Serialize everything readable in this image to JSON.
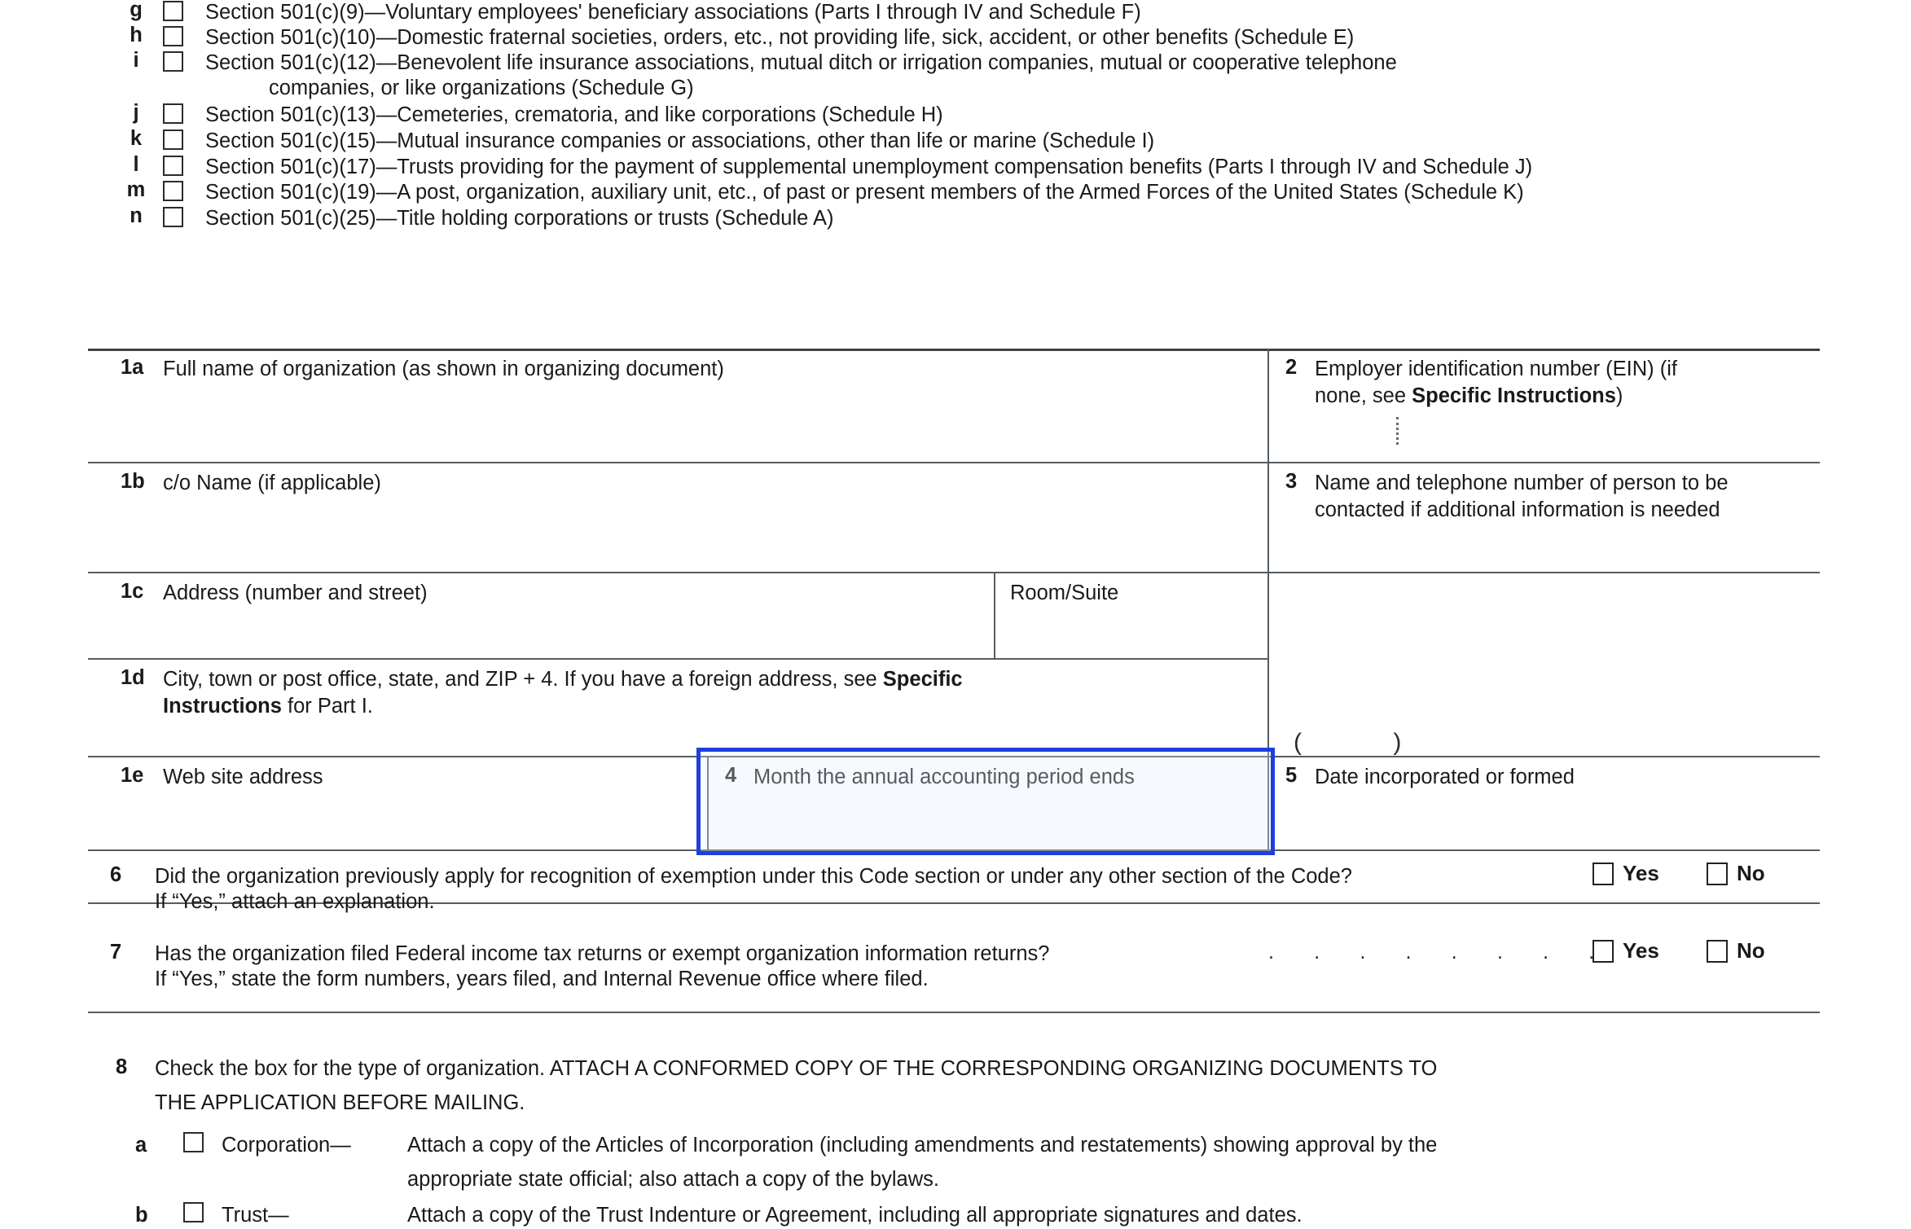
{
  "form": {
    "checkbox_options": [
      {
        "letter": "g",
        "text": "Section 501(c)(9)—Voluntary employees' beneficiary associations (Parts I through IV and Schedule F)"
      },
      {
        "letter": "h",
        "text": "Section 501(c)(10)—Domestic fraternal societies, orders, etc., not providing life, sick, accident, or other benefits (Schedule E)"
      },
      {
        "letter": "i",
        "text": "Section 501(c)(12)—Benevolent life insurance associations, mutual ditch or irrigation companies, mutual or cooperative telephone",
        "continuation": "companies, or like organizations (Schedule G)"
      },
      {
        "letter": "j",
        "text": "Section 501(c)(13)—Cemeteries, crematoria, and like corporations (Schedule H)"
      },
      {
        "letter": "k",
        "text": "Section 501(c)(15)—Mutual insurance companies or associations, other than life or marine (Schedule I)"
      },
      {
        "letter": "l",
        "text": "Section 501(c)(17)—Trusts providing for the payment of supplemental unemployment compensation benefits (Parts I through IV and  Schedule J)"
      },
      {
        "letter": "m",
        "text": "Section 501(c)(19)—A post, organization, auxiliary unit, etc., of past or present members of the Armed Forces of the United States (Schedule K)"
      },
      {
        "letter": "n",
        "text": "Section 501(c)(25)—Title holding corporations or trusts (Schedule A)"
      }
    ],
    "fields": {
      "f1a": {
        "num": "1a",
        "label": "Full name of organization (as shown in organizing document)"
      },
      "f2": {
        "num": "2",
        "label_part1": "Employer identification number (EIN) (if",
        "label_part2_pre": "none, see ",
        "label_part2_bold": "Specific Instructions",
        "label_part2_post": ")"
      },
      "f1b": {
        "num": "1b",
        "label": "c/o Name (if applicable)"
      },
      "f3": {
        "num": "3",
        "label_line1": "Name and telephone number of person to be",
        "label_line2": "contacted if additional information is needed"
      },
      "f1c": {
        "num": "1c",
        "label": "Address (number and street)"
      },
      "room_suite": {
        "label": "Room/Suite"
      },
      "f1d": {
        "num": "1d",
        "label_pre": "City, town or post office, state, and ZIP + 4. If you have a foreign address, see ",
        "label_bold": "Specific",
        "label_line2_bold": "Instructions",
        "label_line2_post": " for Part I."
      },
      "f1e": {
        "num": "1e",
        "label": "Web site address"
      },
      "f4": {
        "num": "4",
        "label": "Month the annual accounting period ends"
      },
      "f5": {
        "num": "5",
        "label": "Date incorporated or formed"
      },
      "phone_paren": "( )"
    },
    "questions": [
      {
        "num": "6",
        "line1": "Did the organization previously apply for recognition of exemption under this Code section or under any other section of the Code?",
        "line2": "If “Yes,” attach an explanation.",
        "yes_label": "Yes",
        "no_label": "No",
        "leaders": ""
      },
      {
        "num": "7",
        "line1": "Has the organization filed Federal income tax returns or exempt organization information returns?",
        "line2": "If “Yes,” state the form numbers, years filed, and Internal Revenue office where filed.",
        "yes_label": "Yes",
        "no_label": "No",
        "leaders": ". . . . . . . ."
      }
    ],
    "item8": {
      "num": "8",
      "line1": "Check the box for the type of organization. ATTACH A CONFORMED COPY OF THE CORRESPONDING ORGANIZING DOCUMENTS TO",
      "line2": "THE APPLICATION BEFORE MAILING.",
      "subitems": [
        {
          "letter": "a",
          "type": "Corporation—",
          "desc_line1": "Attach a copy of the Articles of Incorporation (including amendments and restatements) showing approval by the",
          "desc_line2": "appropriate state official; also attach a copy of the bylaws."
        },
        {
          "letter": "b",
          "type": "Trust—",
          "desc_line1": "Attach a copy of the Trust Indenture or Agreement, including all appropriate signatures and dates.",
          "desc_line2": ""
        }
      ]
    }
  },
  "colors": {
    "highlight_border": "#1d3fe0",
    "rule": "#555c63",
    "text": "#1a1a1a"
  }
}
